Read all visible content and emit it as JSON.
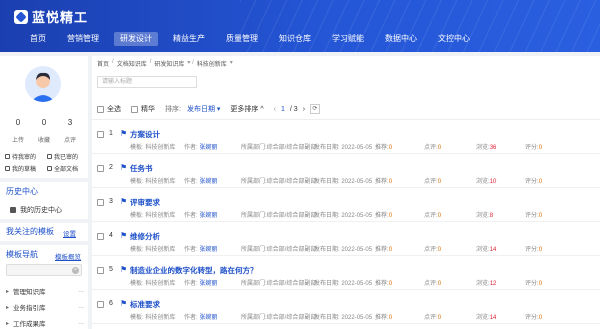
{
  "app": {
    "logo_text": "蓝悦精工"
  },
  "nav": [
    {
      "label": "首页"
    },
    {
      "label": "营销管理"
    },
    {
      "label": "研发设计",
      "active": true
    },
    {
      "label": "精益生产"
    },
    {
      "label": "质量管理"
    },
    {
      "label": "知识仓库"
    },
    {
      "label": "学习赋能"
    },
    {
      "label": "数据中心"
    },
    {
      "label": "文控中心"
    }
  ],
  "sidebar": {
    "stats": [
      {
        "num": "0",
        "label": "上传"
      },
      {
        "num": "0",
        "label": "收藏"
      },
      {
        "num": "3",
        "label": "点评"
      }
    ],
    "quick_links": [
      {
        "label": "待我审的",
        "icon": "clipboard-icon"
      },
      {
        "label": "我已审的",
        "icon": "clipboard-check-icon"
      },
      {
        "label": "我的草稿",
        "icon": "draft-icon"
      },
      {
        "label": "全部文档",
        "icon": "documents-icon"
      }
    ],
    "history_title": "历史中心",
    "history_item": "我的历史中心",
    "followed_title": "我关注的模板",
    "followed_setting": "设置",
    "template_nav_title": "模板导航",
    "template_overview": "模板概览",
    "tree": [
      {
        "label": "管理知识库"
      },
      {
        "label": "业务指引库"
      },
      {
        "label": "工作成果库"
      }
    ]
  },
  "breadcrumb": [
    "首页",
    "文档知识库",
    "研发知识库",
    "科技创新库"
  ],
  "search": {
    "placeholder": "请输入标题"
  },
  "toolbar": {
    "select_all": "全选",
    "featured": "精华",
    "sort_label": "排序:",
    "sort_field": "发布日期",
    "more_sort": "更多排序",
    "page_current": "1",
    "page_total": "/ 3"
  },
  "meta_labels": {
    "template": "模板:",
    "author": "作者:",
    "dept": "所属部门:",
    "date": "发布日期:",
    "recommend": "推荐",
    "reviews": "点评",
    "views": "浏览",
    "rating": "评分"
  },
  "rows": [
    {
      "idx": "1",
      "title": "方案设计",
      "template": "科技创新库",
      "author": "张婉丽",
      "dept": "综合部/综合部副部",
      "date": "2022-05-05",
      "recommend": "0",
      "reviews": "0",
      "views": "36",
      "rating": "0"
    },
    {
      "idx": "2",
      "title": "任务书",
      "template": "科技创新库",
      "author": "张婉丽",
      "dept": "综合部/综合部副部",
      "date": "2022-05-05",
      "recommend": "0",
      "reviews": "0",
      "views": "10",
      "rating": "0"
    },
    {
      "idx": "3",
      "title": "评审要求",
      "template": "科技创新库",
      "author": "张婉丽",
      "dept": "综合部/综合部副部",
      "date": "2022-05-05",
      "recommend": "0",
      "reviews": "0",
      "views": "8",
      "rating": "0"
    },
    {
      "idx": "4",
      "title": "维修分析",
      "template": "科技创新库",
      "author": "张婉丽",
      "dept": "综合部/综合部副部",
      "date": "2022-05-05",
      "recommend": "0",
      "reviews": "0",
      "views": "14",
      "rating": "0"
    },
    {
      "idx": "5",
      "title": "制造业企业的数字化转型，路在何方？",
      "template": "科技创新库",
      "author": "张婉丽",
      "dept": "综合部/综合部副部",
      "date": "2022-05-05",
      "recommend": "0",
      "reviews": "0",
      "views": "12",
      "rating": "0"
    },
    {
      "idx": "6",
      "title": "标准要求",
      "template": "科技创新库",
      "author": "张婉丽",
      "dept": "综合部/综合部副部",
      "date": "2022-05-05",
      "recommend": "0",
      "reviews": "0",
      "views": "14",
      "rating": "0"
    }
  ],
  "colors": {
    "header": "#2456d6",
    "link": "#1d50c8",
    "accent_orange": "#e07000"
  }
}
